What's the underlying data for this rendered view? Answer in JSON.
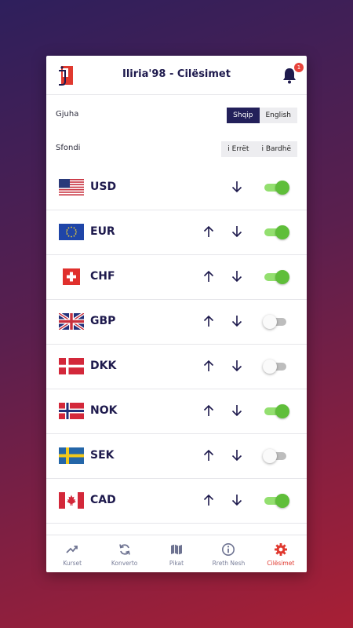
{
  "header": {
    "title": "Iliria'98 - Cilësimet",
    "notification_count": "1",
    "logo_icon": "iliria-logo-icon",
    "bell_icon": "bell-icon"
  },
  "settings": {
    "language": {
      "label": "Gjuha",
      "options": [
        "Shqip",
        "English"
      ],
      "selected": "Shqip"
    },
    "background": {
      "label": "Sfondi",
      "options": [
        "i Errët",
        "i Bardhë"
      ],
      "selected": ""
    }
  },
  "currencies": [
    {
      "code": "USD",
      "flag": "us-flag-icon",
      "up": false,
      "down": true,
      "enabled": true
    },
    {
      "code": "EUR",
      "flag": "eu-flag-icon",
      "up": true,
      "down": true,
      "enabled": true
    },
    {
      "code": "CHF",
      "flag": "ch-flag-icon",
      "up": true,
      "down": true,
      "enabled": true
    },
    {
      "code": "GBP",
      "flag": "gb-flag-icon",
      "up": true,
      "down": true,
      "enabled": false
    },
    {
      "code": "DKK",
      "flag": "dk-flag-icon",
      "up": true,
      "down": true,
      "enabled": false
    },
    {
      "code": "NOK",
      "flag": "no-flag-icon",
      "up": true,
      "down": true,
      "enabled": true
    },
    {
      "code": "SEK",
      "flag": "se-flag-icon",
      "up": true,
      "down": true,
      "enabled": false
    },
    {
      "code": "CAD",
      "flag": "ca-flag-icon",
      "up": true,
      "down": true,
      "enabled": true
    }
  ],
  "tabs": [
    {
      "label": "Kurset",
      "icon": "trending-up-icon",
      "active": false
    },
    {
      "label": "Konverto",
      "icon": "refresh-icon",
      "active": false
    },
    {
      "label": "Pikat",
      "icon": "map-icon",
      "active": false
    },
    {
      "label": "Rreth Nesh",
      "icon": "info-icon",
      "active": false
    },
    {
      "label": "Cilësimet",
      "icon": "gear-icon",
      "active": true
    }
  ],
  "colors": {
    "primary": "#1e1a4d",
    "accent": "#e0392f",
    "toggle_on": "#5fbe3a",
    "segment_active": "#23205a"
  }
}
